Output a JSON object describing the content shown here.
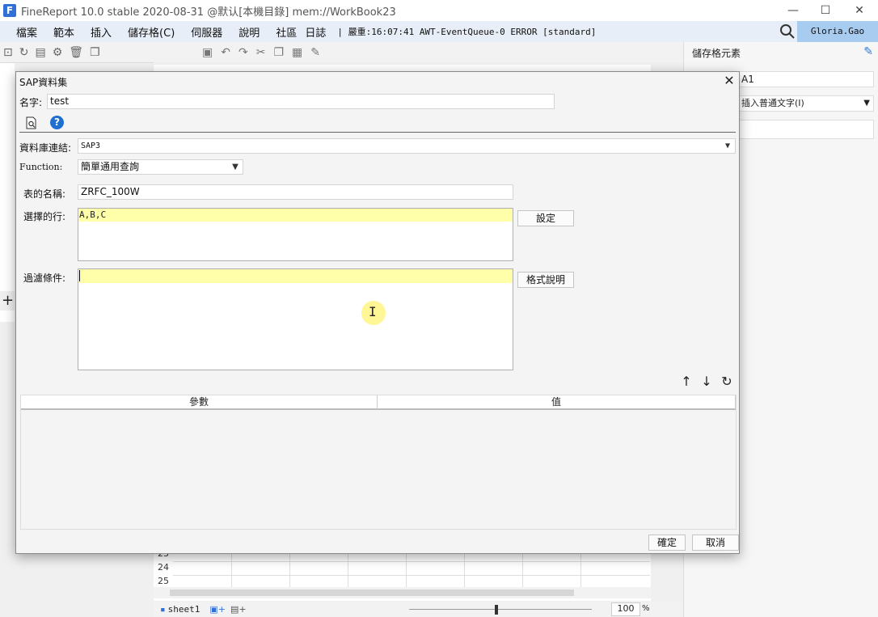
{
  "window": {
    "title": "FineReport 10.0 stable 2020-08-31 @默认[本機目錄]     mem://WorkBook23",
    "minimize": "—",
    "maximize": "☐",
    "close": "✕"
  },
  "menu": {
    "items": [
      "檔案",
      "範本",
      "插入",
      "儲存格(C)",
      "伺服器",
      "說明",
      "社區",
      "日誌"
    ],
    "log_text": "| 嚴重:16:07:41 AWT-EventQueue-0 ERROR [standard]",
    "user": "Gloria.Gao"
  },
  "right_panel": {
    "title": "儲存格元素",
    "cell_name": "A1",
    "insert_type": "插入普通文字(I)"
  },
  "sheet": {
    "rows": [
      "23",
      "24",
      "25"
    ],
    "tab": "sheet1",
    "zoom": "100",
    "zoom_unit": "%"
  },
  "dialog": {
    "title": "SAP資料集",
    "name_label": "名字:",
    "name_value": "test",
    "db_label": "資料庫連結:",
    "db_value": "SAP3",
    "function_label": "Function:",
    "function_value": "簡單通用查詢",
    "table_label": "表的名稱:",
    "table_value": "ZRFC_100W",
    "columns_label": "選擇的行:",
    "columns_value": "A,B,C",
    "set_button": "設定",
    "filter_label": "過濾條件:",
    "filter_value": "",
    "format_help_button": "格式說明",
    "params_columns": [
      "參數",
      "值"
    ],
    "ok_button": "確定",
    "cancel_button": "取消"
  },
  "colors": {
    "highlight_line": "#ffffaa",
    "accent": "#1f6fd1",
    "user_badge": "#a8cbf0"
  }
}
